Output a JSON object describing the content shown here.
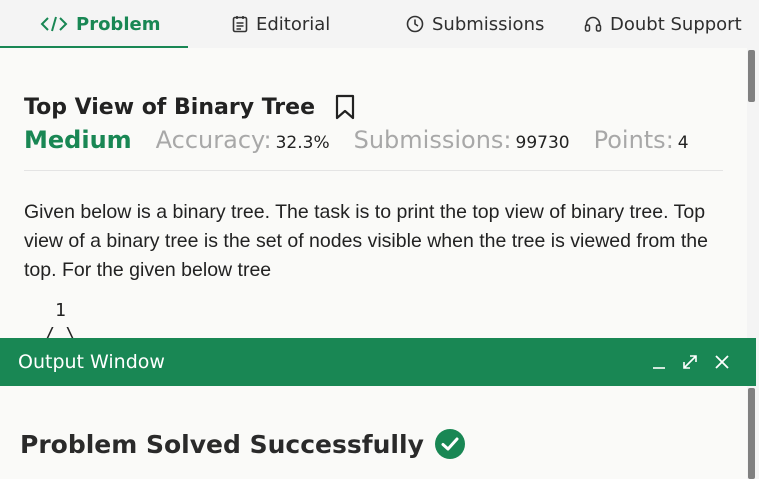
{
  "tabs": [
    {
      "label": "Problem",
      "icon": "code-icon",
      "active": true
    },
    {
      "label": "Editorial",
      "icon": "editorial-icon",
      "active": false
    },
    {
      "label": "Submissions",
      "icon": "clock-icon",
      "active": false
    },
    {
      "label": "Doubt Support",
      "icon": "headset-icon",
      "active": false
    }
  ],
  "problem": {
    "title": "Top View of Binary Tree",
    "difficulty": "Medium",
    "accuracy_label": "Accuracy:",
    "accuracy_value": "32.3%",
    "submissions_label": "Submissions:",
    "submissions_value": "99730",
    "points_label": "Points:",
    "points_value": "4",
    "description": "Given below is a binary tree. The task is to print the top view of binary tree. Top view of a binary tree is the set of nodes visible when the tree is viewed from the top. For the given below tree",
    "tree_root": "1",
    "tree_branches": "/  \\"
  },
  "output_window": {
    "title": "Output Window",
    "minimize_label": "_",
    "result": "Problem Solved Successfully"
  },
  "colors": {
    "accent": "#198754",
    "muted": "#a8a8a8",
    "text": "#222222"
  }
}
